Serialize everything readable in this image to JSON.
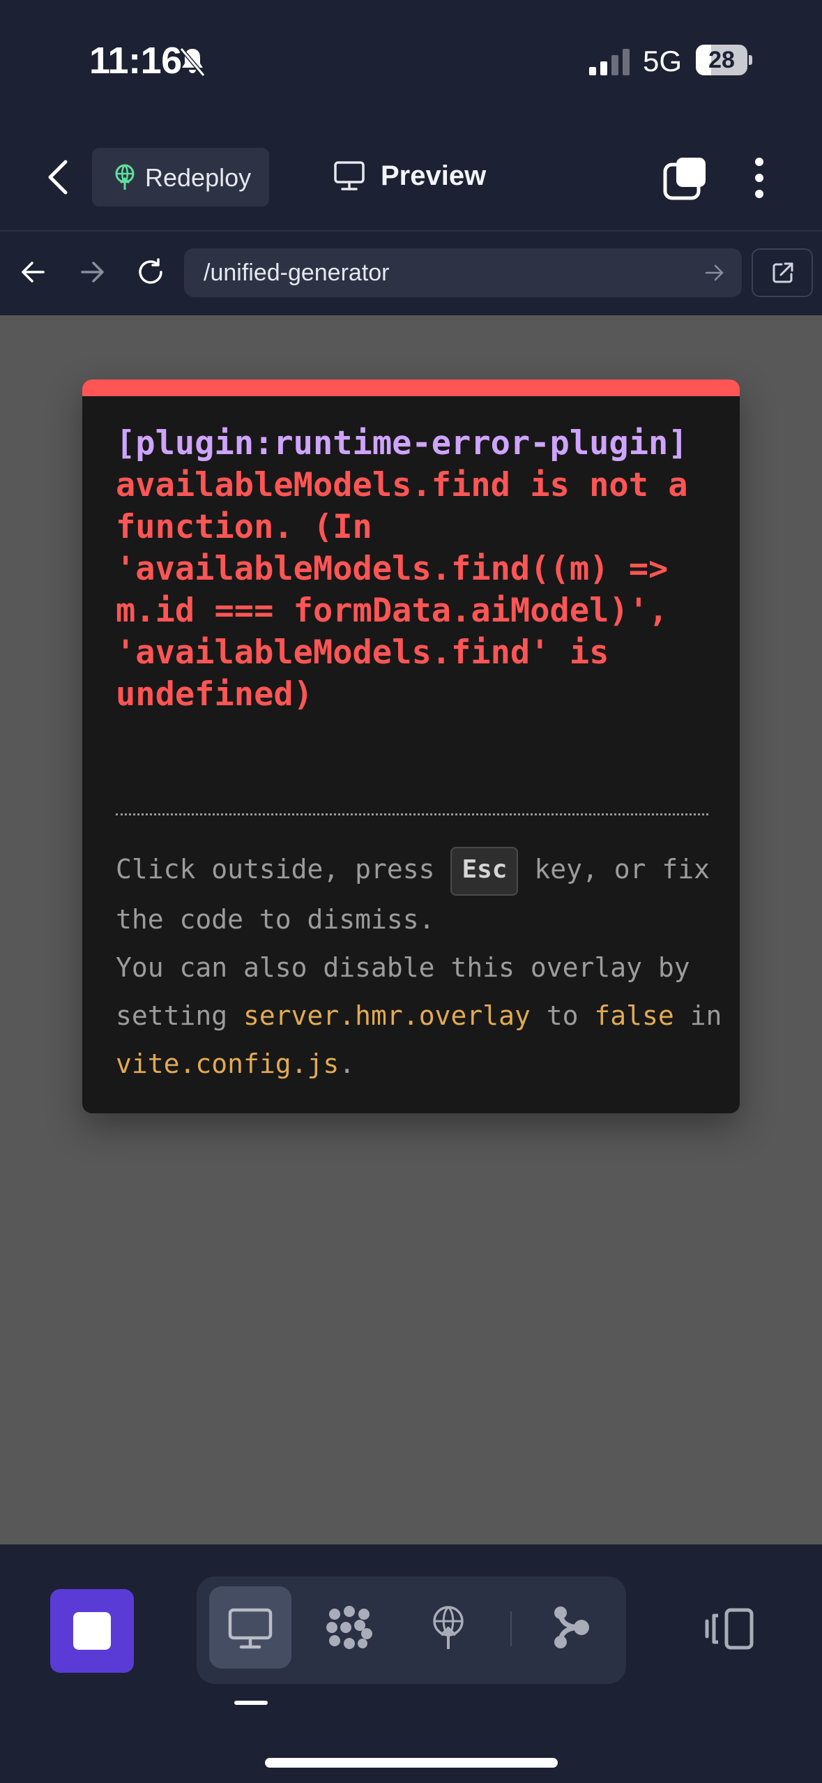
{
  "status_bar": {
    "time": "11:16",
    "network": "5G",
    "battery": "28"
  },
  "toolbar": {
    "redeploy_label": "Redeploy",
    "preview_label": "Preview"
  },
  "address_bar": {
    "url": "/unified-generator"
  },
  "error_overlay": {
    "plugin": "[plugin:runtime-error-plugin]",
    "message": "availableModels.find is not a\nfunction. (In\n'availableModels.find((m) =>\nm.id === formData.aiModel)',\n'availableModels.find' is\nundefined)",
    "tip": {
      "part1": "Click outside, press ",
      "key": "Esc",
      "part2": " key, or fix the code to dismiss.",
      "part3": "You can also disable this overlay by setting ",
      "code1": "server.hmr.overlay",
      "part4": " to ",
      "code2": "false",
      "part5": " in ",
      "code3": "vite.config.js",
      "part6": "."
    }
  },
  "colors": {
    "background": "#1c2133",
    "content_bg": "#585858",
    "error_red": "#ff5555",
    "plugin_purple": "#cfa4ff",
    "code_orange": "#e2aa53",
    "stop_button": "#5b3bd6"
  },
  "bottom_bar": {
    "tabs": [
      "monitor-icon",
      "dots-pattern-icon",
      "network-antenna-icon",
      "branch-icon"
    ],
    "active_tab": 0
  }
}
